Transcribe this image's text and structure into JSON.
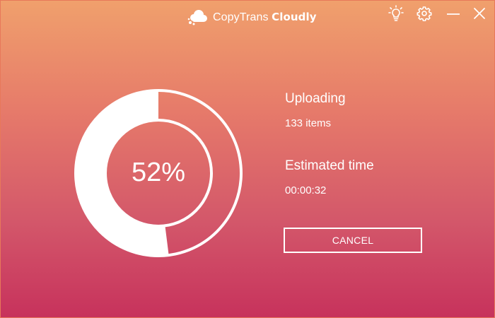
{
  "app": {
    "title_light": "CopyTrans",
    "title_bold": "Cloudly",
    "logo_icon": "cloud-cluster-icon"
  },
  "titlebar": {
    "icons": [
      "lightbulb-icon",
      "gear-icon",
      "minimize-icon",
      "close-icon"
    ]
  },
  "progress": {
    "percent_label": "52%",
    "fraction": 0.52
  },
  "status": {
    "title": "Uploading",
    "items": "133 items",
    "estimate_title": "Estimated time",
    "estimate_value": "00:00:32"
  },
  "actions": {
    "cancel_label": "CANCEL"
  },
  "colors": {
    "gradient_top": "#f0a06c",
    "gradient_bottom": "#c7325c",
    "foreground": "#ffffff",
    "border": "#e8785a"
  }
}
